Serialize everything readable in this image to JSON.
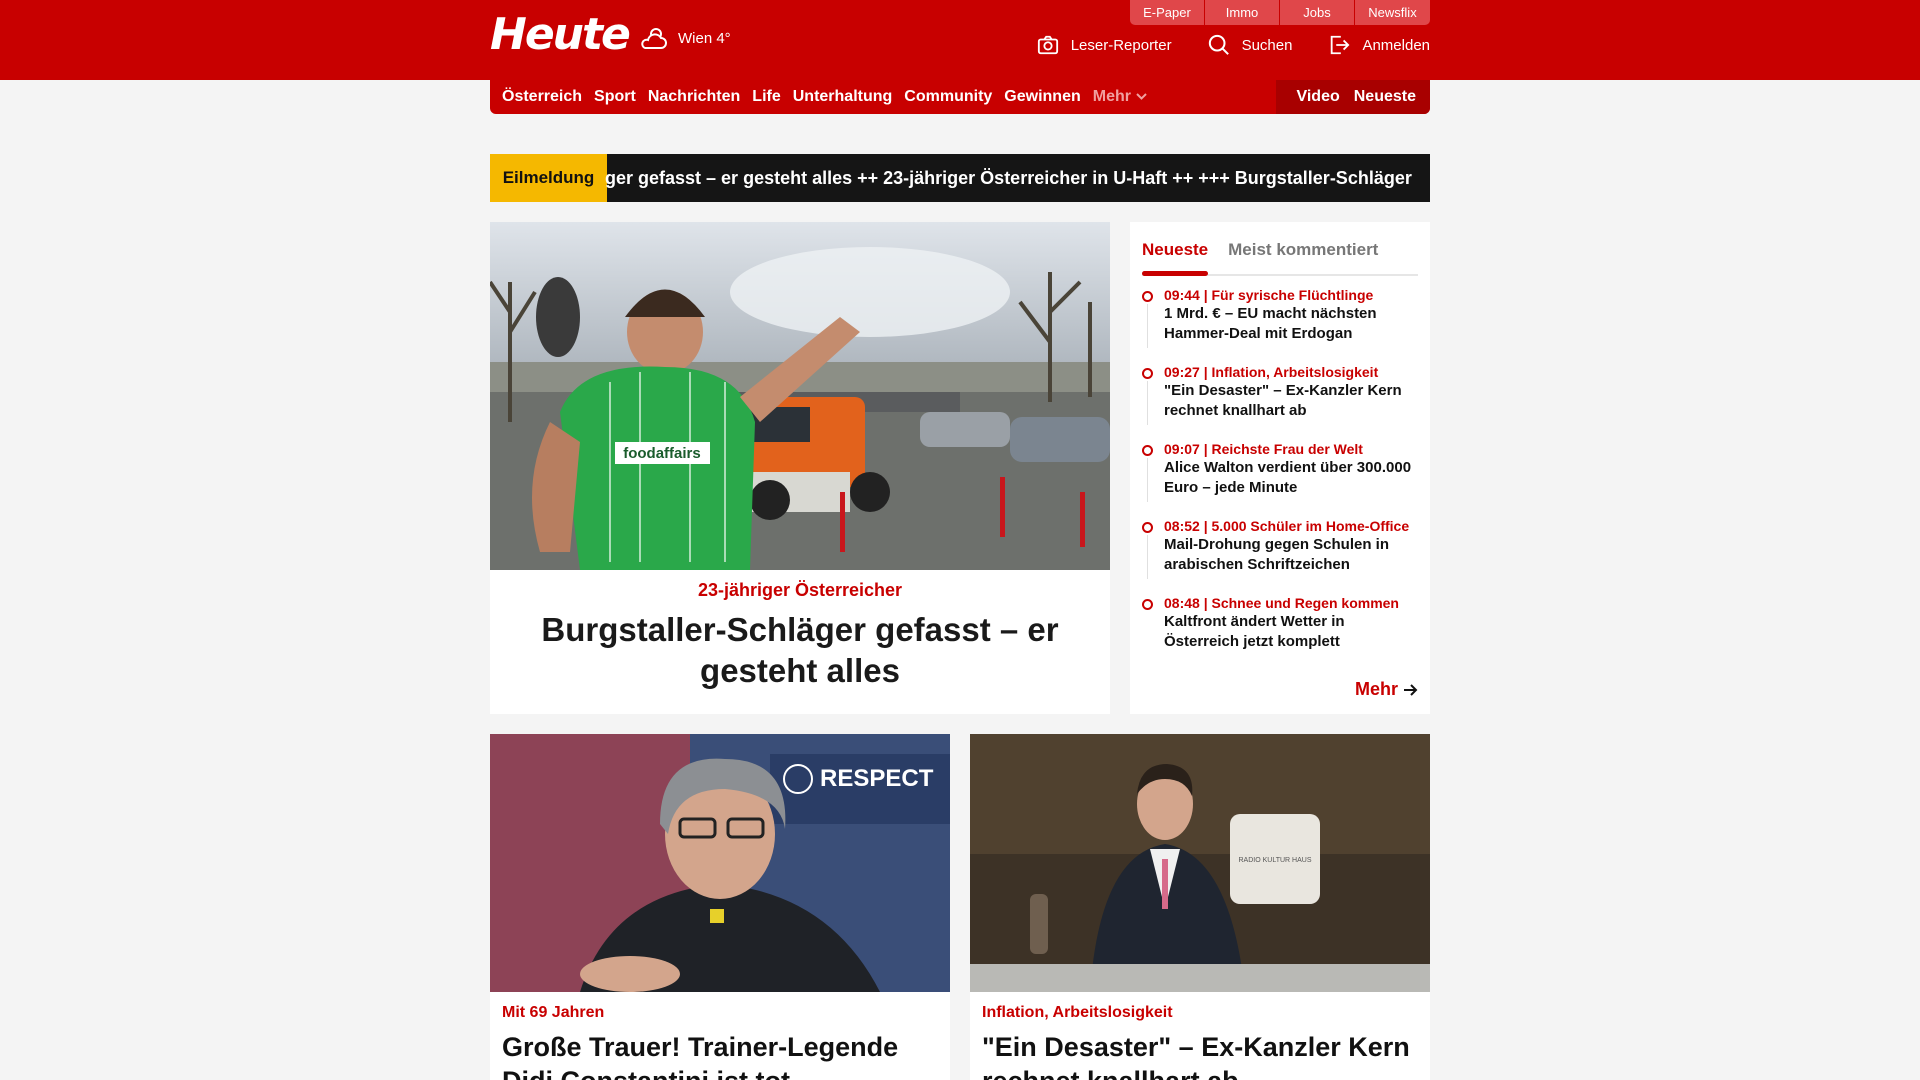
{
  "header": {
    "logo": "Heute",
    "weather": "Wien 4°",
    "top_tabs": [
      "E-Paper",
      "Immo",
      "Jobs",
      "Newsflix"
    ],
    "actions": {
      "reporter": "Leser-Reporter",
      "search": "Suchen",
      "login": "Anmelden"
    }
  },
  "nav": {
    "items": [
      "Österreich",
      "Sport",
      "Nachrichten",
      "Life",
      "Unterhaltung",
      "Community",
      "Gewinnen"
    ],
    "more": "Mehr",
    "video": "Video",
    "latest": "Neueste"
  },
  "ticker": {
    "label": "Eilmeldung",
    "text": "ger gefasst – er gesteht alles ++ 23-jähriger Österreicher in U-Haft ++  +++  Burgstaller-Schläger"
  },
  "hero": {
    "kicker": "23-jähriger Österreicher",
    "title": "Burgstaller-Schläger gefasst – er gesteht alles",
    "image_text": "foodaffairs"
  },
  "panel": {
    "tabs": [
      "Neueste",
      "Meist kommentiert"
    ],
    "items": [
      {
        "meta": "09:44 | Für syrische Flüchtlinge",
        "title": "1 Mrd. € – EU macht nächsten Hammer-Deal mit Erdogan"
      },
      {
        "meta": "09:27 | Inflation, Arbeitslosigkeit",
        "title": "\"Ein Desaster\" – Ex-Kanzler Kern rechnet knallhart ab"
      },
      {
        "meta": "09:07 | Reichste Frau der Welt",
        "title": "Alice Walton verdient über 300.000 Euro – jede Minute"
      },
      {
        "meta": "08:52 | 5.000 Schüler im Home-Office",
        "title": "Mail-Drohung gegen Schulen in arabischen Schriftzeichen"
      },
      {
        "meta": "08:48 | Schnee und Regen kommen",
        "title": "Kaltfront ändert Wetter in Österreich jetzt komplett"
      }
    ],
    "more": "Mehr"
  },
  "cards": [
    {
      "kicker": "Mit 69 Jahren",
      "title": "Große Trauer! Trainer-Legende Didi Constantini ist tot",
      "image_text": "RESPECT"
    },
    {
      "kicker": "Inflation, Arbeitslosigkeit",
      "title": "\"Ein Desaster\" – Ex-Kanzler Kern rechnet knallhart ab",
      "image_text": "RADIO KULTUR HAUS"
    }
  ],
  "colors": {
    "brand": "#c80000",
    "ticker_label": "#f5b800",
    "ticker_bg": "#151515"
  }
}
